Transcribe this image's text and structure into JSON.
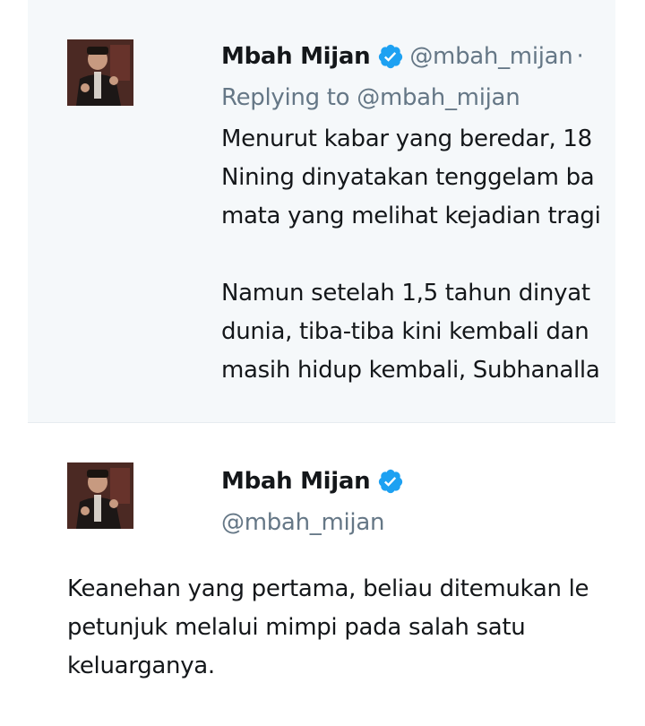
{
  "colors": {
    "parent_background": "#f5f8fa",
    "text_primary": "#14171a",
    "text_secondary": "#657786",
    "verified_blue": "#1da1f2",
    "border": "#e6ecf0"
  },
  "parent_tweet": {
    "author": {
      "display_name": "Mbah Mijan",
      "verified_icon": "verified-badge-icon",
      "handle": "@mbah_mijan",
      "separator": "·"
    },
    "replying_to": "Replying to @mbah_mijan",
    "paragraphs": [
      [
        "Menurut kabar yang beredar, 18",
        "Nining dinyatakan tenggelam ba",
        "mata yang melihat kejadian tragi"
      ],
      [
        "Namun setelah 1,5 tahun dinyat",
        "dunia, tiba-tiba kini kembali dan",
        "masih hidup kembali, Subhanalla"
      ]
    ]
  },
  "main_tweet": {
    "author": {
      "display_name": "Mbah Mijan",
      "verified_icon": "verified-badge-icon",
      "handle": "@mbah_mijan"
    },
    "lines": [
      "Keanehan yang pertama, beliau ditemukan le",
      "petunjuk melalui mimpi pada salah satu",
      "keluarganya."
    ]
  }
}
